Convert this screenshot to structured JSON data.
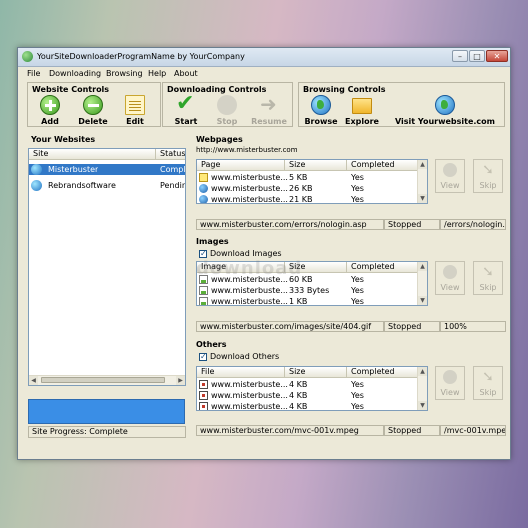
{
  "window": {
    "title": "YourSiteDownloaderProgramName by YourCompany",
    "controls": {
      "minimize": "–",
      "maximize": "□",
      "close": "✕"
    }
  },
  "menu": [
    "File",
    "Downloading",
    "Browsing",
    "Help",
    "About"
  ],
  "toolbar": {
    "website_controls": {
      "title": "Website Controls",
      "buttons": [
        {
          "label": "Add",
          "icon": "add-icon",
          "enabled": true
        },
        {
          "label": "Delete",
          "icon": "delete-icon",
          "enabled": true
        },
        {
          "label": "Edit",
          "icon": "edit-icon",
          "enabled": true
        }
      ]
    },
    "downloading_controls": {
      "title": "Downloading Controls",
      "buttons": [
        {
          "label": "Start",
          "icon": "check-icon",
          "enabled": true
        },
        {
          "label": "Stop",
          "icon": "stop-icon",
          "enabled": false
        },
        {
          "label": "Resume",
          "icon": "arrow-right-icon",
          "enabled": false
        }
      ]
    },
    "browsing_controls": {
      "title": "Browsing Controls",
      "buttons": [
        {
          "label": "Browse",
          "icon": "globe-icon",
          "enabled": true
        },
        {
          "label": "Explore",
          "icon": "folder-icon",
          "enabled": true
        },
        {
          "label": "Visit Yourwebsite.com",
          "icon": "globe-icon",
          "enabled": true
        }
      ]
    }
  },
  "websites": {
    "title": "Your Websites",
    "columns": [
      "Site",
      "Status"
    ],
    "rows": [
      {
        "site": "Misterbuster",
        "status": "Compl",
        "selected": true
      },
      {
        "site": "Rebrandsoftware",
        "status": "Pendin",
        "selected": false
      }
    ],
    "site_progress": "Site Progress: Complete"
  },
  "webpages": {
    "title": "Webpages",
    "url": "http://www.misterbuster.com",
    "columns": [
      "Page",
      "Size",
      "Completed"
    ],
    "rows": [
      {
        "name": "www.misterbuste...",
        "size": "5 KB",
        "completed": "Yes",
        "icon": "warning-page-icon"
      },
      {
        "name": "www.misterbuste...",
        "size": "26 KB",
        "completed": "Yes",
        "icon": "globe-page-icon"
      },
      {
        "name": "www.misterbuste...",
        "size": "21 KB",
        "completed": "Yes",
        "icon": "globe-page-icon"
      }
    ],
    "status": {
      "url": "www.misterbuster.com/errors/nologin.asp",
      "state": "Stopped",
      "file": "/errors/nologin."
    },
    "view_label": "View",
    "skip_label": "Skip"
  },
  "images": {
    "title": "Images",
    "checkbox_label": "Download Images",
    "checked": true,
    "columns": [
      "Image",
      "Size",
      "Completed"
    ],
    "rows": [
      {
        "name": "www.misterbuste...",
        "size": "60 KB",
        "completed": "Yes"
      },
      {
        "name": "www.misterbuste...",
        "size": "333 Bytes",
        "completed": "Yes"
      },
      {
        "name": "www.misterbuste...",
        "size": "1 KB",
        "completed": "Yes"
      }
    ],
    "status": {
      "url": "www.misterbuster.com/images/site/404.gif",
      "state": "Stopped",
      "file": "100%"
    },
    "view_label": "View",
    "skip_label": "Skip"
  },
  "others": {
    "title": "Others",
    "checkbox_label": "Download Others",
    "checked": true,
    "columns": [
      "File",
      "Size",
      "Completed"
    ],
    "rows": [
      {
        "name": "www.misterbuste...",
        "size": "4 KB",
        "completed": "Yes"
      },
      {
        "name": "www.misterbuste...",
        "size": "4 KB",
        "completed": "Yes"
      },
      {
        "name": "www.misterbuste...",
        "size": "4 KB",
        "completed": "Yes"
      }
    ],
    "status": {
      "url": "www.misterbuster.com/mvc-001v.mpeg",
      "state": "Stopped",
      "file": "/mvc-001v.mpe"
    },
    "view_label": "View",
    "skip_label": "Skip"
  },
  "watermark": "download"
}
